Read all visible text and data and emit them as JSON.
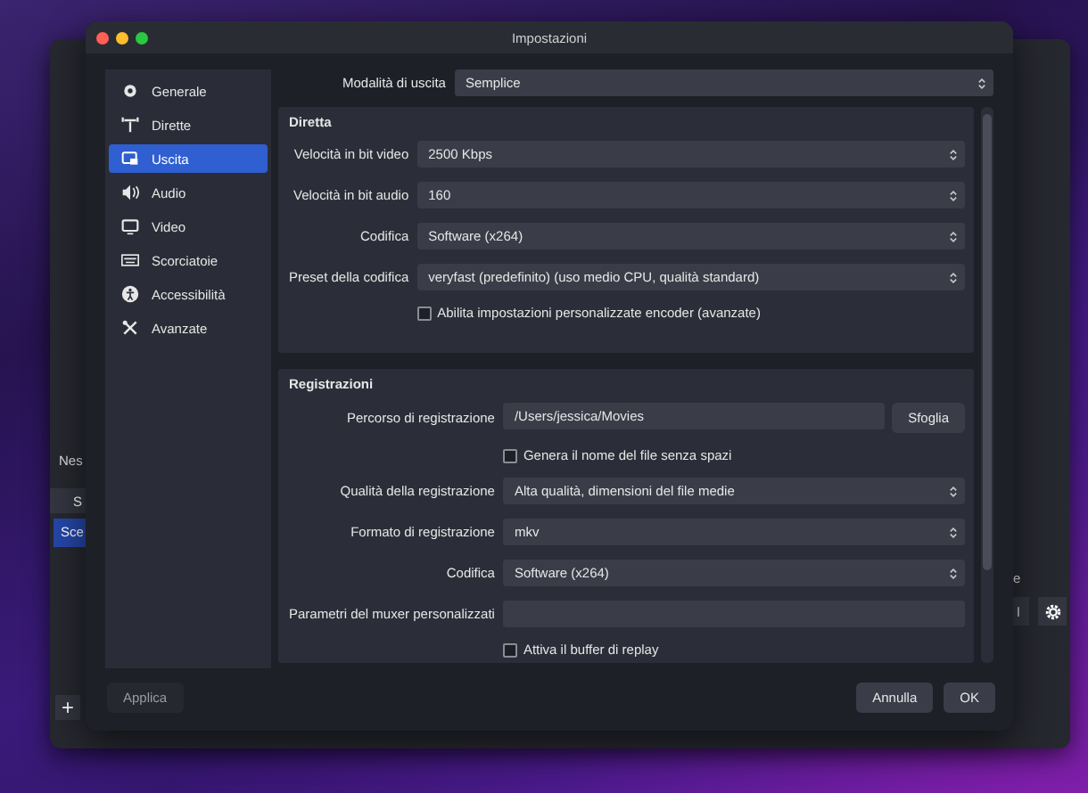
{
  "background_window": {
    "label": "Nes",
    "dock_header": "S",
    "scene": {
      "label": "Sce",
      "selected": true
    },
    "add_button": "+",
    "right_label": "e",
    "right_button": "l"
  },
  "dialog": {
    "title": "Impostazioni",
    "sidebar": [
      {
        "label": "Generale",
        "selected": false
      },
      {
        "label": "Dirette",
        "selected": false
      },
      {
        "label": "Uscita",
        "selected": true
      },
      {
        "label": "Audio",
        "selected": false
      },
      {
        "label": "Video",
        "selected": false
      },
      {
        "label": "Scorciatoie",
        "selected": false
      },
      {
        "label": "Accessibilità",
        "selected": false
      },
      {
        "label": "Avanzate",
        "selected": false
      }
    ],
    "output_mode": {
      "label": "Modalità di uscita",
      "value": "Semplice"
    },
    "sections": [
      {
        "title": "Diretta",
        "rows": [
          {
            "kind": "spin",
            "label": "Velocità in bit video",
            "value": "2500 Kbps"
          },
          {
            "kind": "spin",
            "label": "Velocità in bit audio",
            "value": "160"
          },
          {
            "kind": "select",
            "label": "Codifica",
            "value": "Software (x264)"
          },
          {
            "kind": "select",
            "label": "Preset della codifica",
            "value": "veryfast (predefinito) (uso medio CPU, qualità standard)"
          },
          {
            "kind": "checkbox",
            "label": "Abilita impostazioni personalizzate encoder (avanzate)",
            "checked": false
          }
        ]
      },
      {
        "title": "Registrazioni",
        "rows": [
          {
            "kind": "path",
            "label": "Percorso di registrazione",
            "value": "/Users/jessica/Movies",
            "button": "Sfoglia"
          },
          {
            "kind": "checkbox",
            "label": "Genera il nome del file senza spazi",
            "checked": false
          },
          {
            "kind": "select",
            "label": "Qualità della registrazione",
            "value": "Alta qualità, dimensioni del file medie"
          },
          {
            "kind": "select",
            "label": "Formato di registrazione",
            "value": "mkv"
          },
          {
            "kind": "select",
            "label": "Codifica",
            "value": "Software (x264)"
          },
          {
            "kind": "text",
            "label": "Parametri del muxer personalizzati"
          },
          {
            "kind": "checkbox",
            "label": "Attiva il buffer di replay",
            "checked": false
          }
        ]
      }
    ],
    "buttons": {
      "apply": "Applica",
      "cancel": "Annulla",
      "ok": "OK"
    }
  }
}
